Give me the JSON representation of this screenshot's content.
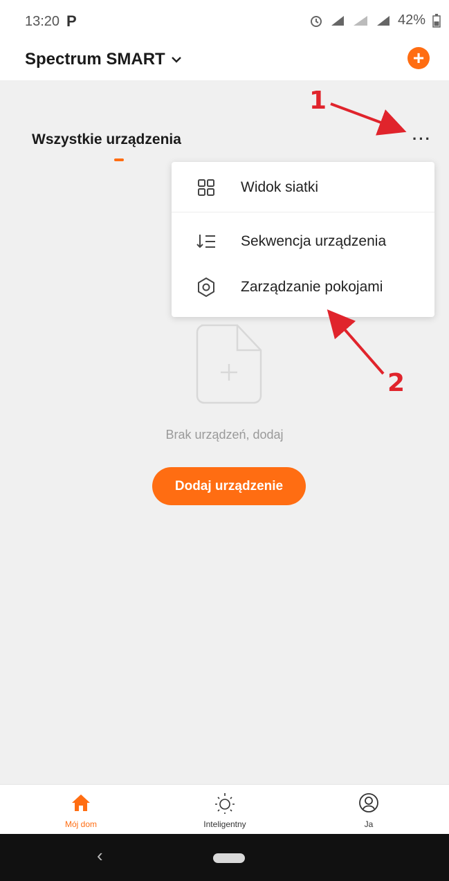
{
  "status_bar": {
    "time": "13:20",
    "app_glyph": "P",
    "battery": "42%"
  },
  "header": {
    "home_name": "Spectrum SMART",
    "add_icon": "plus-circle-icon"
  },
  "section": {
    "title": "Wszystkie urządzenia",
    "more": "···"
  },
  "menu": {
    "items": [
      {
        "label": "Widok siatki",
        "icon": "grid-icon"
      },
      {
        "label": "Sekwencja urządzenia",
        "icon": "sort-list-icon"
      },
      {
        "label": "Zarządzanie pokojami",
        "icon": "gear-icon"
      }
    ]
  },
  "empty_state": {
    "text": "Brak urządzeń, dodaj",
    "button": "Dodaj urządzenie"
  },
  "annotations": {
    "one": "1",
    "two": "2",
    "color": "#e0242c"
  },
  "tabbar": {
    "tabs": [
      {
        "label": "Mój dom",
        "icon": "home-icon",
        "active": true
      },
      {
        "label": "Inteligentny",
        "icon": "sun-icon",
        "active": false
      },
      {
        "label": "Ja",
        "icon": "user-circle-icon",
        "active": false
      }
    ]
  },
  "navbar": {
    "back": "‹"
  },
  "colors": {
    "accent": "#ff6d12",
    "background": "#f0f0f0",
    "annotation": "#e0242c"
  }
}
